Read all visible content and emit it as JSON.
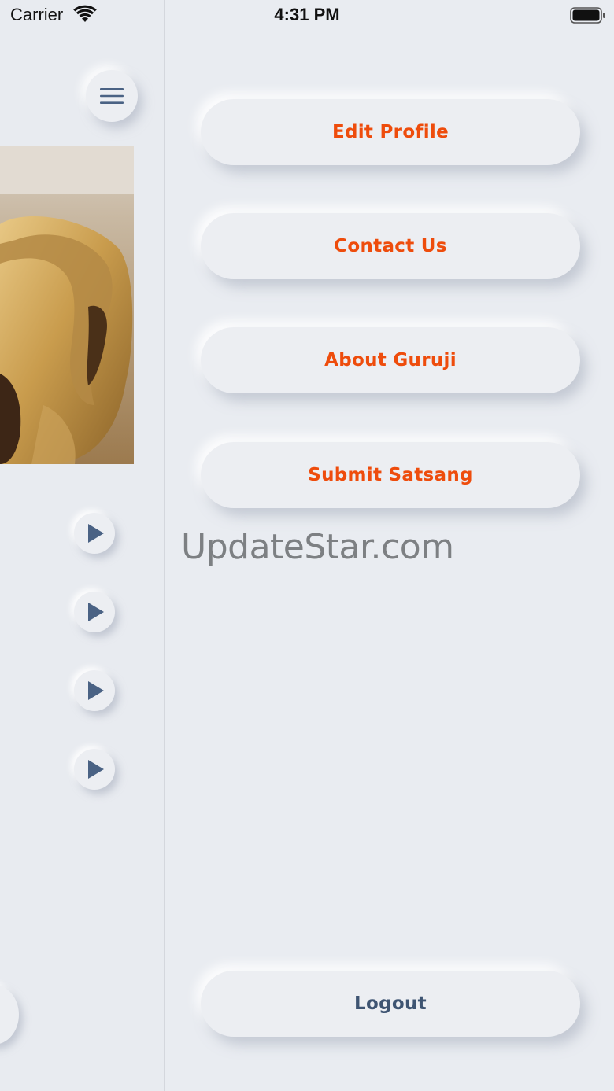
{
  "status_bar": {
    "carrier": "Carrier",
    "time": "4:31 PM",
    "icons": [
      "wifi-icon",
      "battery-icon"
    ]
  },
  "home": {
    "menu_icon": "hamburger-icon",
    "play_icon": "play-icon",
    "play_buttons_count": 4
  },
  "drawer": {
    "items": [
      {
        "label": "Edit Profile"
      },
      {
        "label": "Contact Us"
      },
      {
        "label": "About Guruji"
      },
      {
        "label": "Submit Satsang"
      }
    ],
    "logout_label": "Logout",
    "watermark": "UpdateStar.com"
  },
  "colors": {
    "background": "#e8ebf0",
    "accent": "#ee4c0c",
    "logout_text": "#3e5472",
    "icon": "#4a6284"
  }
}
